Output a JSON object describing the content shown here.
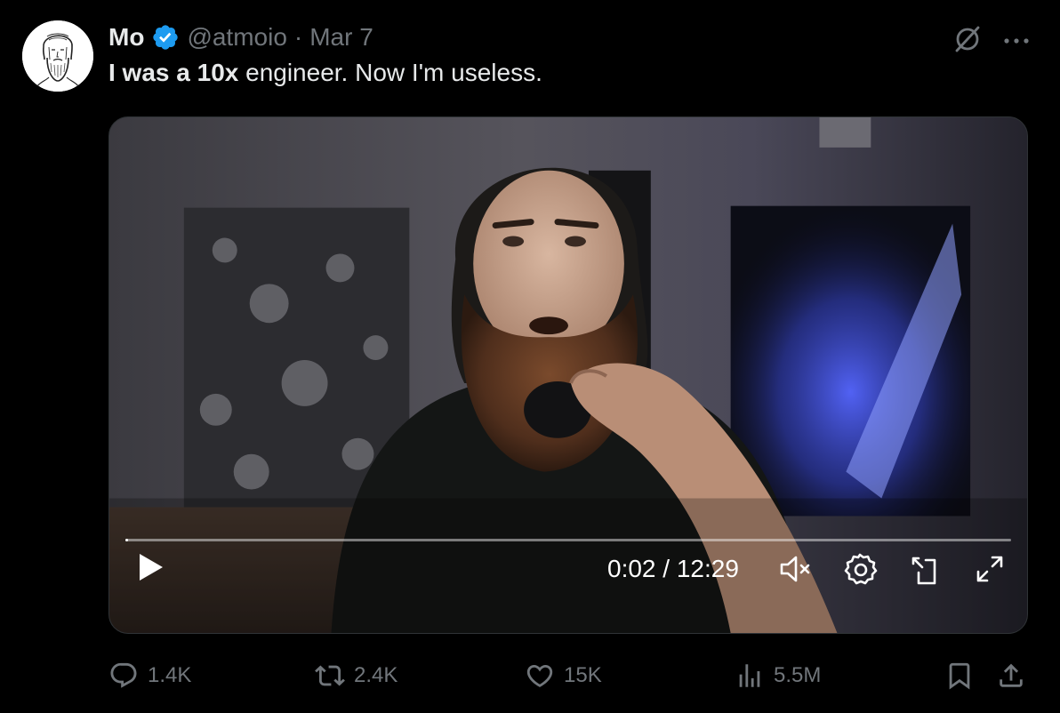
{
  "author": {
    "name": "Mo",
    "handle": "@atmoio",
    "separator": "·",
    "date": "Mar 7",
    "verified": true,
    "avatar_icon": "bearded-man-sketch-avatar"
  },
  "tweet": {
    "text_bold_1": "I was a ",
    "text_bold_2": "10x",
    "text_rest": " engineer. Now I'm useless."
  },
  "top_icons": [
    "grok-slash-icon",
    "more-icon"
  ],
  "video": {
    "time_label": "0:02 / 12:29",
    "progress_fraction": 0.002,
    "controls": [
      "play-icon",
      "mute-icon",
      "settings-icon",
      "dock-icon",
      "fullscreen-icon"
    ]
  },
  "actions": {
    "replies": "1.4K",
    "reposts": "2.4K",
    "likes": "15K",
    "views": "5.5M"
  },
  "colors": {
    "background": "#000000",
    "text": "#e7e9ea",
    "secondary": "#71767b",
    "verified": "#1d9bf0"
  }
}
